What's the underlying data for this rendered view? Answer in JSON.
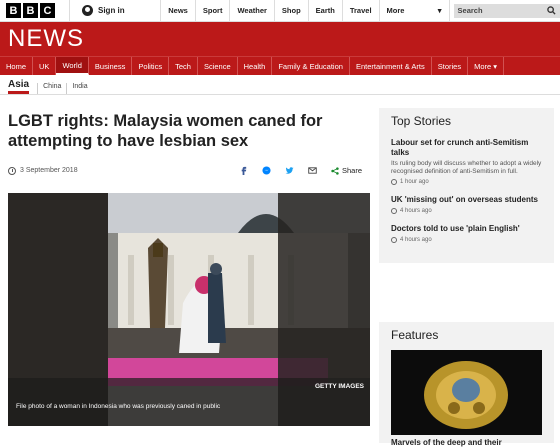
{
  "topbar": {
    "logo": [
      "B",
      "B",
      "C"
    ],
    "signin": "Sign in",
    "nav": [
      "News",
      "Sport",
      "Weather",
      "Shop",
      "Earth",
      "Travel"
    ],
    "more": "More",
    "search_placeholder": "Search"
  },
  "news_bar": {
    "title": "NEWS"
  },
  "section_nav": [
    "Home",
    "UK",
    "World",
    "Business",
    "Politics",
    "Tech",
    "Science",
    "Health",
    "Family & Education",
    "Entertainment & Arts",
    "Stories",
    "More ▾"
  ],
  "sub_nav": {
    "active": "Asia",
    "items": [
      "China",
      "India"
    ]
  },
  "article": {
    "headline": "LGBT rights: Malaysia women caned for attempting to have lesbian sex",
    "date": "3 September 2018",
    "share_label": "Share",
    "photo_caption": "File photo of a woman in Indonesia who was previously caned in public",
    "photo_credit": "GETTY IMAGES"
  },
  "top_stories": {
    "heading": "Top Stories",
    "items": [
      {
        "title": "Labour set for crunch anti-Semitism talks",
        "summary": "Its ruling body will discuss whether to adopt a widely recognised definition of anti-Semitism in full.",
        "time": "1 hour ago"
      },
      {
        "title": "UK 'missing out' on overseas students",
        "summary": "",
        "time": "4 hours ago"
      },
      {
        "title": "Doctors told to use 'plain English'",
        "summary": "",
        "time": "4 hours ago"
      }
    ]
  },
  "features": {
    "heading": "Features",
    "first_title": "Marvels of the deep and their"
  },
  "colors": {
    "brand_red": "#bb1919"
  }
}
